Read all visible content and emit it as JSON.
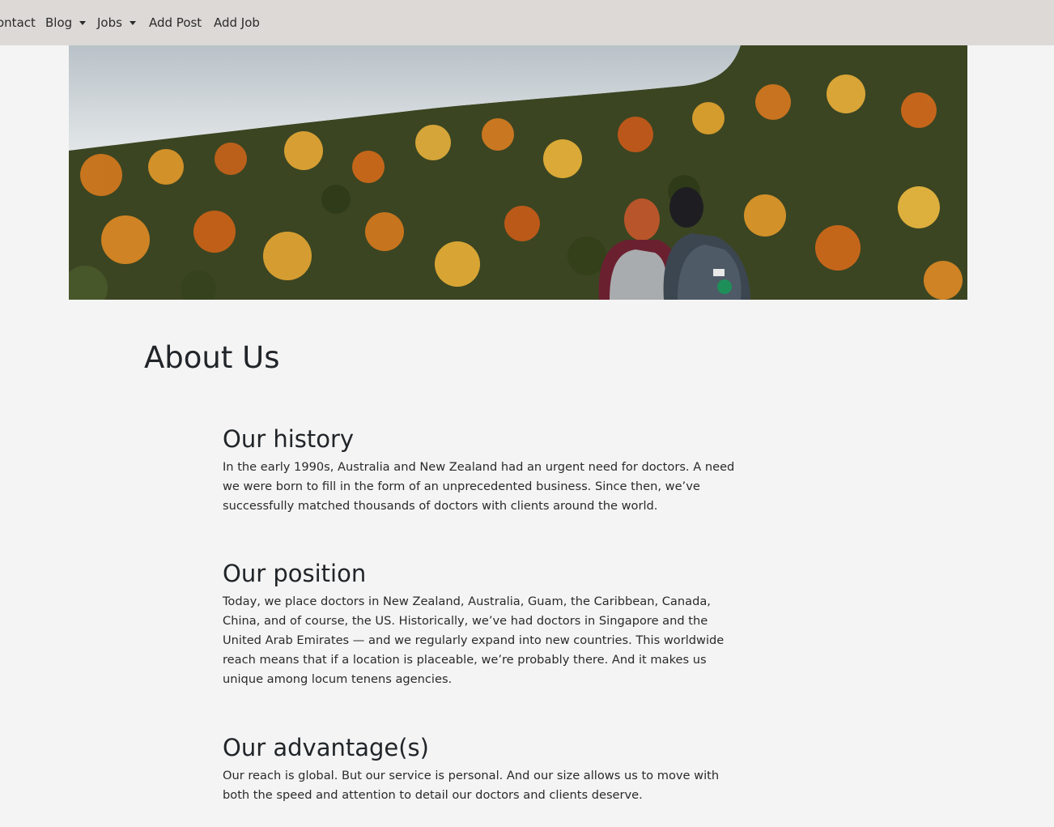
{
  "nav": {
    "items": [
      {
        "label": "ontact",
        "dropdown": false
      },
      {
        "label": "Blog",
        "dropdown": true
      },
      {
        "label": "Jobs",
        "dropdown": true
      },
      {
        "label": "Add Post",
        "dropdown": false
      },
      {
        "label": "Add Job",
        "dropdown": false
      }
    ]
  },
  "hero": {
    "icon": "autumn-forest-hikers-photo"
  },
  "page": {
    "title": "About Us"
  },
  "sections": [
    {
      "heading": "Our history",
      "body": "In the early 1990s, Australia and New Zealand had an urgent need for doctors. A need we were born to fill in the form of an unprecedented business. Since then, we’ve successfully matched thousands of doctors with clients around the world."
    },
    {
      "heading": "Our position",
      "body": "Today, we place doctors in New Zealand, Australia, Guam, the Caribbean, Canada, China, and of course, the US. Historically, we’ve had doctors in Singapore and the United Arab Emirates — and we regularly expand into new countries. This worldwide reach means that if a location is placeable, we’re probably there. And it makes us unique among locum tenens agencies."
    },
    {
      "heading": "Our advantage(s)",
      "body": "Our reach is global. But our service is personal. And our size allows us to move with both the speed and attention to detail our doctors and clients deserve."
    }
  ],
  "colors": {
    "navbar": "#dcd9d6",
    "background": "#f4f4f4",
    "text": "#212529"
  }
}
